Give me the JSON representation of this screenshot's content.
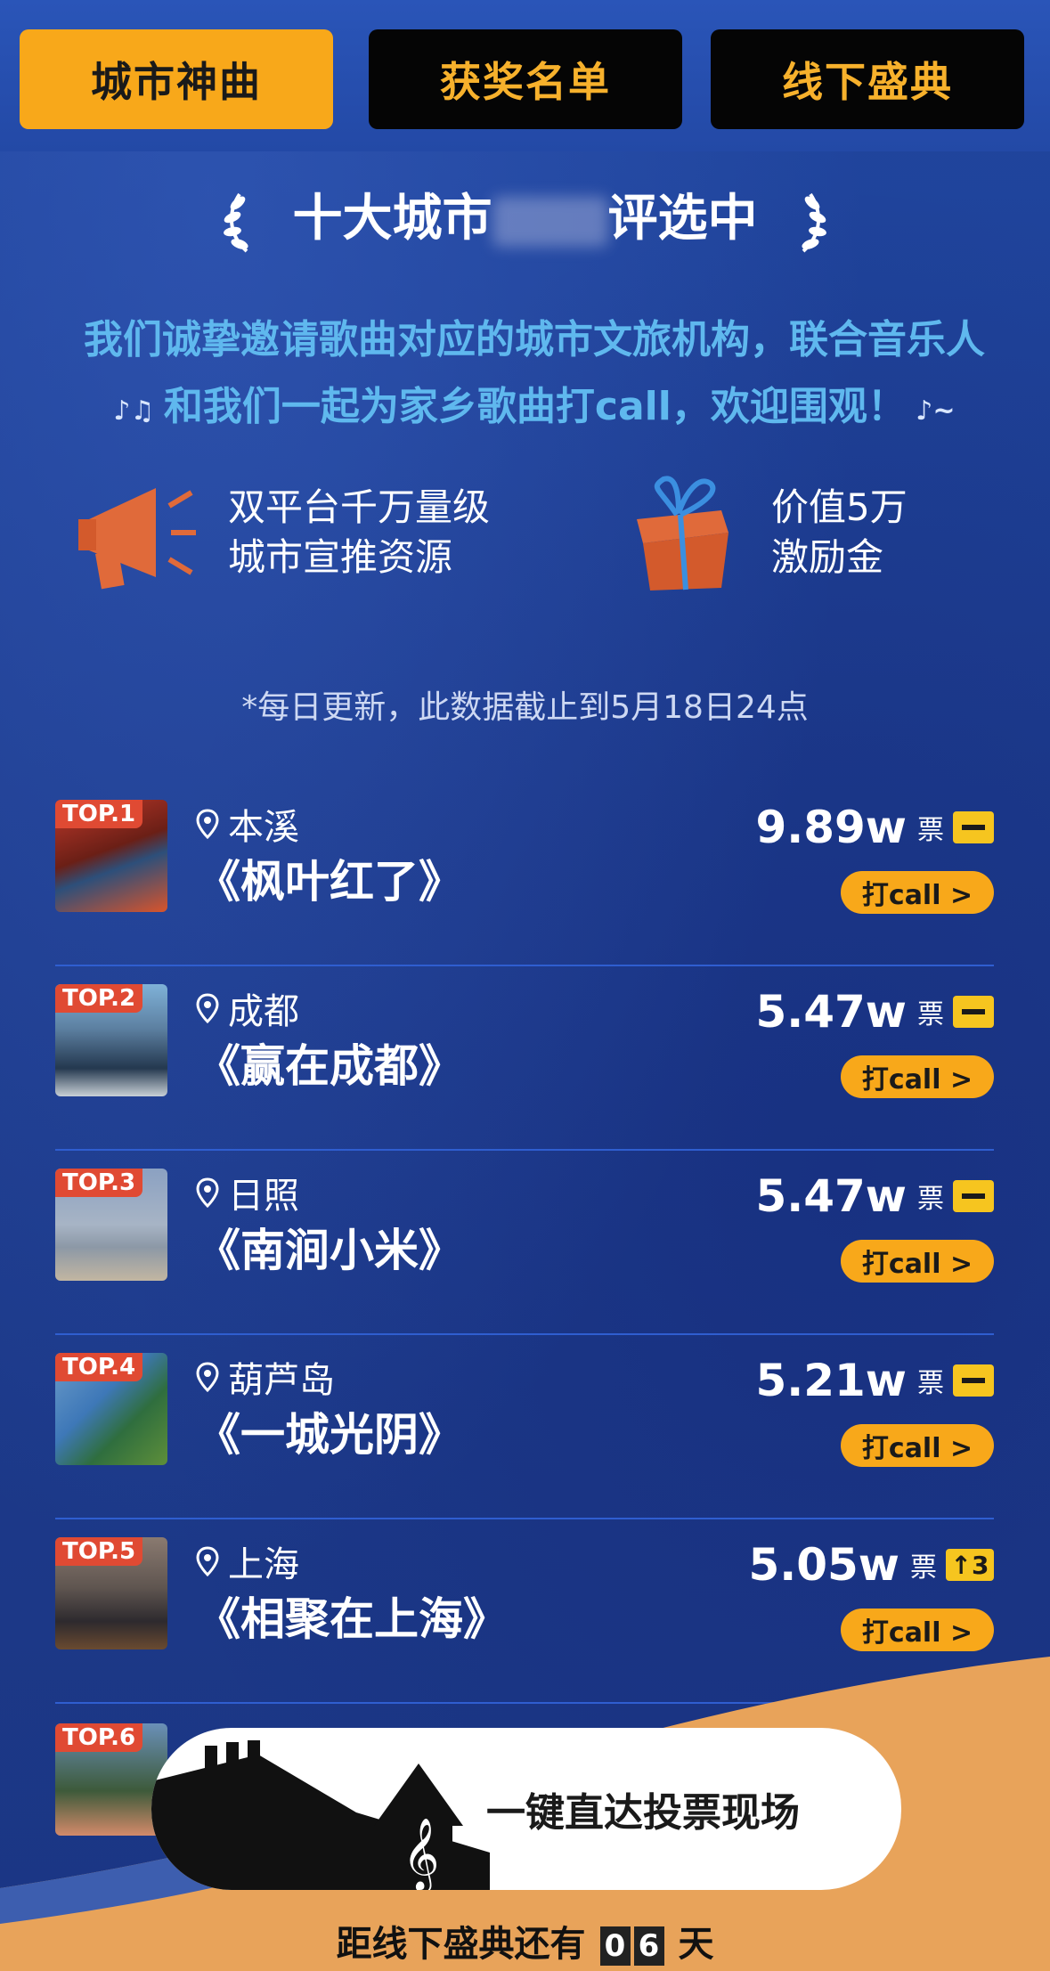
{
  "tabs": [
    {
      "label": "城市神曲"
    },
    {
      "label": "获奖名单"
    },
    {
      "label": "线下盛典"
    }
  ],
  "heading": {
    "prefix": "十大城市",
    "suffix": "评选中"
  },
  "invite": {
    "line1": "我们诚挚邀请歌曲对应的城市文旅机构，联合音乐人",
    "line2": "和我们一起为家乡歌曲打call，欢迎围观！"
  },
  "features": [
    {
      "icon": "megaphone-icon",
      "line1": "双平台千万量级",
      "line2": "城市宣推资源"
    },
    {
      "icon": "gift-box-icon",
      "line1": "价值5万",
      "line2": "激励金"
    }
  ],
  "update_note": "*每日更新，此数据截止到5月18日24点",
  "rankings": [
    {
      "badge": "TOP.1",
      "city": "本溪",
      "song": "《枫叶红了》",
      "votes": "9.89w",
      "unit": "票",
      "trend": "",
      "call": "打call >"
    },
    {
      "badge": "TOP.2",
      "city": "成都",
      "song": "《赢在成都》",
      "votes": "5.47w",
      "unit": "票",
      "trend": "",
      "call": "打call >"
    },
    {
      "badge": "TOP.3",
      "city": "日照",
      "song": "《南涧小米》",
      "votes": "5.47w",
      "unit": "票",
      "trend": "",
      "call": "打call >"
    },
    {
      "badge": "TOP.4",
      "city": "葫芦岛",
      "song": "《一城光阴》",
      "votes": "5.21w",
      "unit": "票",
      "trend": "",
      "call": "打call >"
    },
    {
      "badge": "TOP.5",
      "city": "上海",
      "song": "《相聚在上海》",
      "votes": "5.05w",
      "unit": "票",
      "trend": "↑3",
      "call": "打call >"
    }
  ],
  "partial_badge": "TOP.6",
  "cta": {
    "label": "一键直达投票现场"
  },
  "countdown": {
    "prefix": "距线下盛典还有",
    "d1": "0",
    "d2": "6",
    "suffix": "天"
  },
  "colors": {
    "accent": "#f8a81a",
    "badge": "#e04a33",
    "background": "#1f3a8a",
    "invite_text": "#5fb8ee"
  }
}
